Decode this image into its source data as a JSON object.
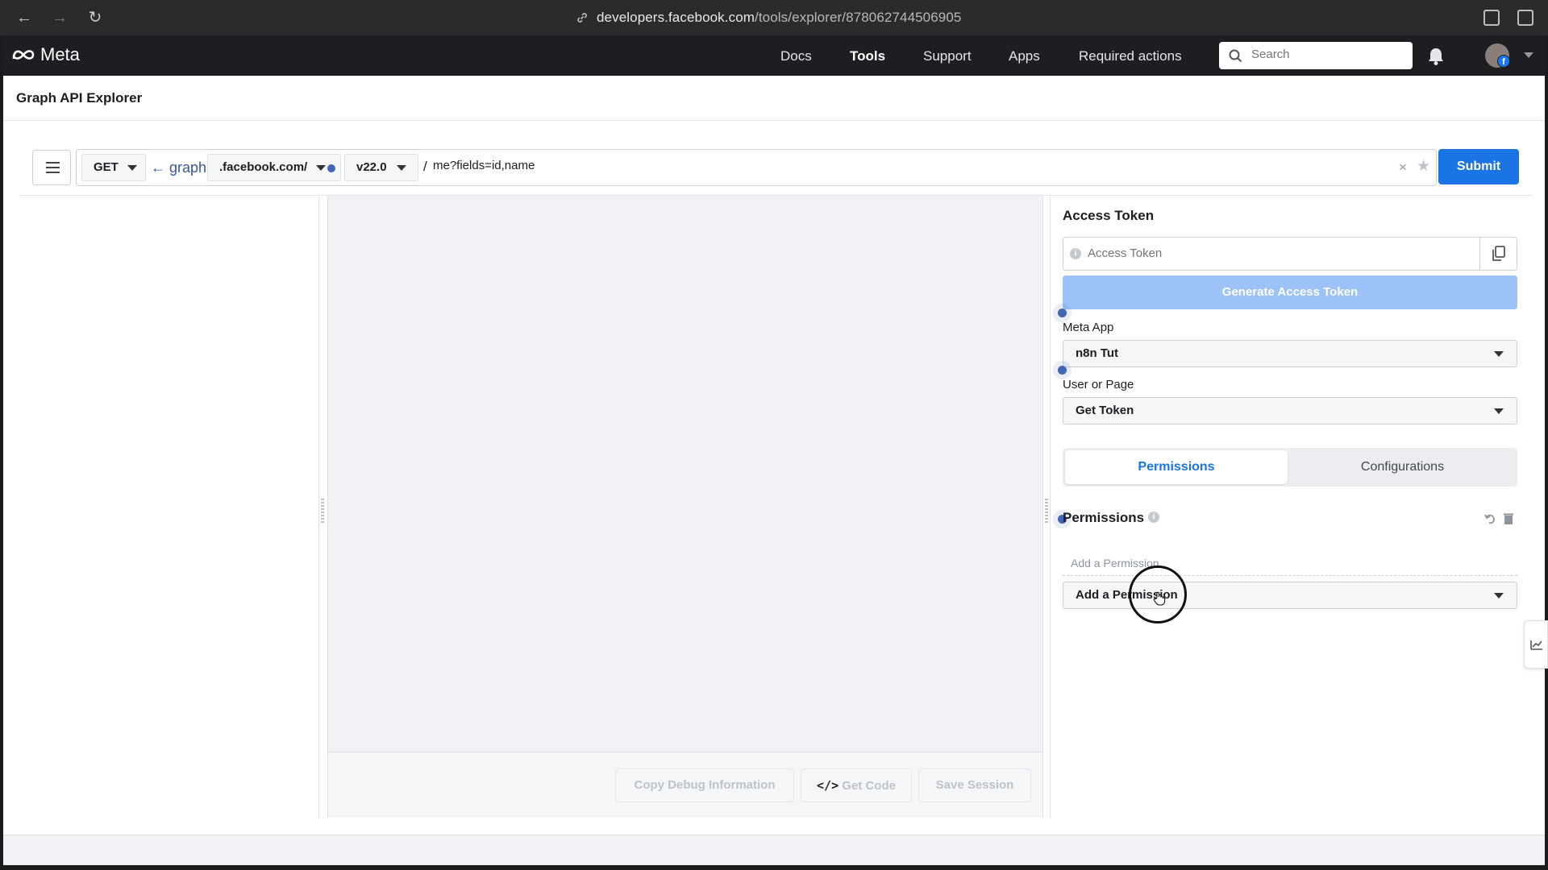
{
  "browser": {
    "url_domain": "developers.facebook.com",
    "url_path": "/tools/explorer/878062744506905"
  },
  "header": {
    "brand": "Meta",
    "nav": [
      {
        "label": "Docs",
        "active": false
      },
      {
        "label": "Tools",
        "active": true
      },
      {
        "label": "Support",
        "active": false
      },
      {
        "label": "Apps",
        "active": false
      },
      {
        "label": "Required actions",
        "active": false
      }
    ],
    "search_placeholder": "Search"
  },
  "page": {
    "title": "Graph API Explorer"
  },
  "query": {
    "method": "GET",
    "graph_link": "← graph.",
    "domain": ".facebook.com/",
    "version": "v22.0",
    "separator": "/",
    "path": "me?fields=id,name",
    "submit_label": "Submit"
  },
  "footer_buttons": {
    "copy_debug": "Copy Debug Information",
    "get_code": "Get Code",
    "save_session": "Save Session"
  },
  "right_panel": {
    "access_token_title": "Access Token",
    "access_token_placeholder": "Access Token",
    "generate_label": "Generate Access Token",
    "meta_app_label": "Meta App",
    "meta_app_value": "n8n Tut",
    "user_or_page_label": "User or Page",
    "user_or_page_value": "Get Token",
    "tabs": [
      {
        "label": "Permissions",
        "active": true
      },
      {
        "label": "Configurations",
        "active": false
      }
    ],
    "permissions_title": "Permissions",
    "add_permission_placeholder": "Add a Permission",
    "add_permission_select": "Add a Permission"
  },
  "colors": {
    "primary": "#1b74e4",
    "primary_disabled": "#9cc2f7",
    "header_bg": "#1c1e21"
  }
}
